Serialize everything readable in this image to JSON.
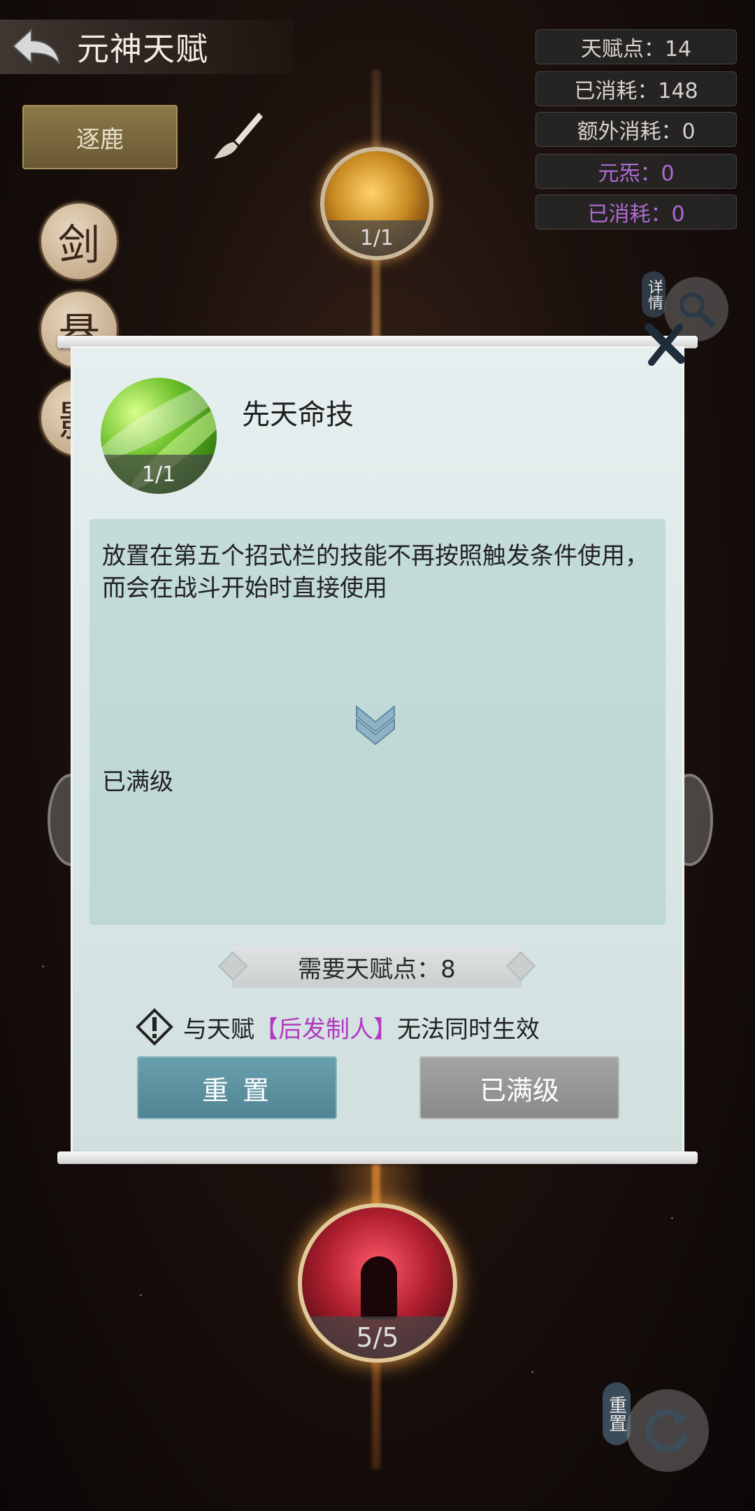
{
  "header": {
    "title": "元神天赋"
  },
  "stats": {
    "talent_points": "天赋点：14",
    "consumed": "已消耗：148",
    "extra_consumed": "额外消耗：0",
    "yuanyan": "元炁：0",
    "yuanyan_consumed": "已消耗：0"
  },
  "toolbar": {
    "zhulu_label": "逐鹿"
  },
  "side_tabs": [
    "剑",
    "悬",
    "影"
  ],
  "tree": {
    "top_node_level": "1/1",
    "bottom_node_level": "5/5"
  },
  "detail_label": "详情",
  "reset_corner_label": "重置",
  "modal": {
    "skill_name": "先天命技",
    "skill_level": "1/1",
    "description": "放置在第五个招式栏的技能不再按照触发条件使用，而会在战斗开始时直接使用",
    "status": "已满级",
    "requirement": "需要天赋点：8",
    "conflict_prefix": "与天赋",
    "conflict_talent": "【后发制人】",
    "conflict_suffix": "无法同时生效",
    "reset_button": "重 置",
    "maxed_button": "已满级"
  },
  "colors": {
    "purple_stat": "#b06ad0",
    "highlight": "#b23ac2",
    "reset_button": "#5f95a2",
    "maxed_button": "#969696"
  }
}
